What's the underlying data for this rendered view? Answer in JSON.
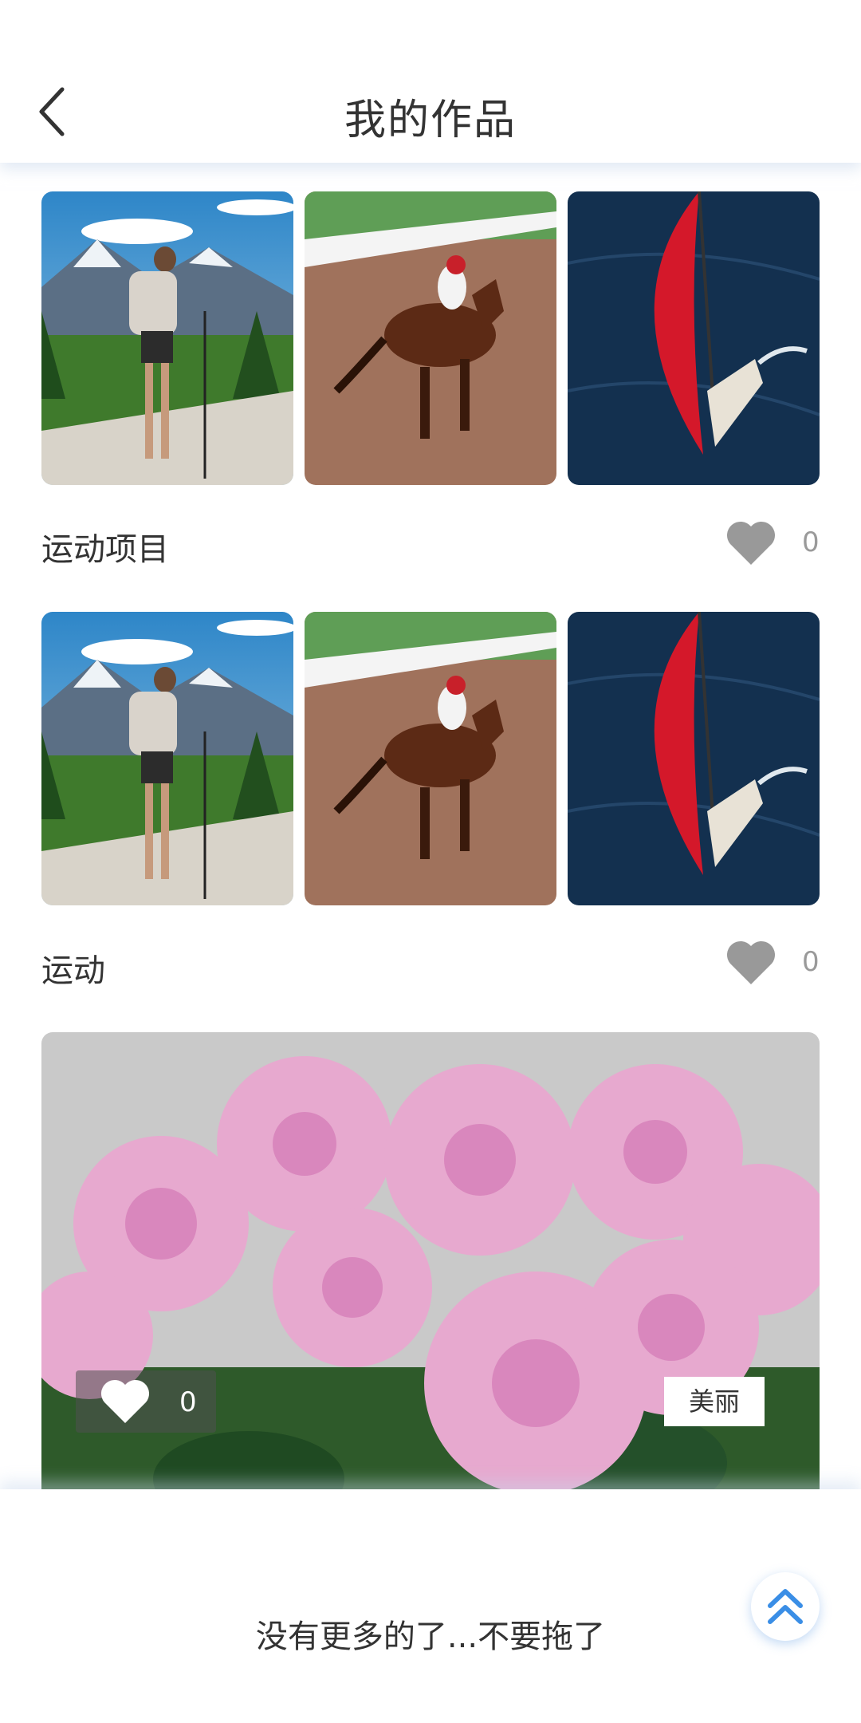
{
  "header": {
    "title": "我的作品",
    "back_icon": "chevron-left-icon"
  },
  "works": [
    {
      "title": "运动项目",
      "likes": "0",
      "images": [
        "hiker-mountains",
        "racehorse-track",
        "red-sailboat"
      ]
    },
    {
      "title": "运动",
      "likes": "0",
      "images": [
        "hiker-mountains",
        "racehorse-track",
        "red-sailboat"
      ]
    }
  ],
  "featured": {
    "likes": "0",
    "tag": "美丽",
    "image": "pink-roses"
  },
  "footer": {
    "end_text": "没有更多的了...不要拖了",
    "top_icon": "double-chevron-up-icon"
  },
  "colors": {
    "heart_gray": "#999999",
    "accent_blue": "#3a8ee6"
  }
}
